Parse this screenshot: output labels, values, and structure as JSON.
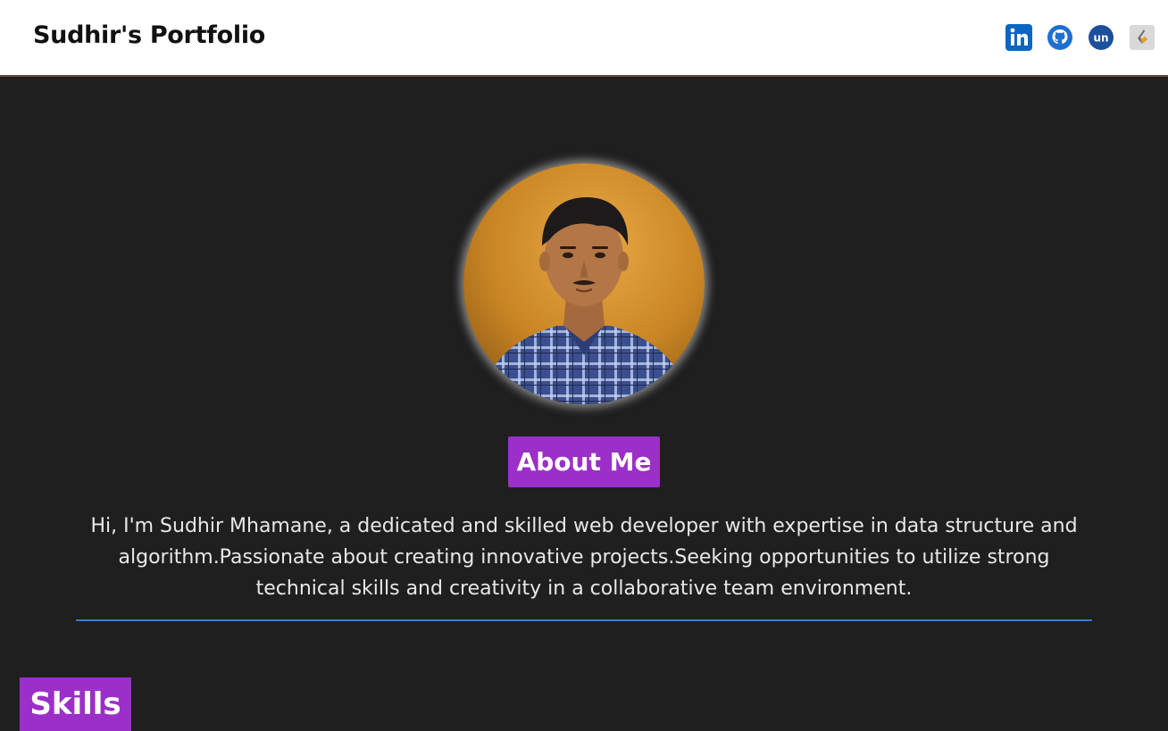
{
  "header": {
    "brand": "Sudhir's Portfolio",
    "socials": [
      {
        "name": "linkedin-icon",
        "label": "in",
        "color": "#0a66c2"
      },
      {
        "name": "github-icon",
        "label": "github",
        "color": "#1f6fd1"
      },
      {
        "name": "unstop-icon",
        "label": "un",
        "color": "#1c4f9c"
      },
      {
        "name": "other-profile-icon",
        "label": "profile",
        "color": "#d9d9d9"
      }
    ]
  },
  "about": {
    "title": "About Me",
    "text": "Hi, I'm Sudhir Mhamane, a dedicated and skilled web developer with expertise in data structure and algorithm.Passionate about creating innovative projects.Seeking opportunities to utilize strong technical skills and creativity in a collaborative team environment."
  },
  "skills": {
    "title": "Skills"
  },
  "colors": {
    "background": "#1f1f1f",
    "accent": "#9b2fc7",
    "divider": "#2f7fd0"
  }
}
